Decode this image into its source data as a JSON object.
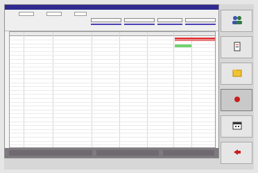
{
  "window": {
    "title": ""
  },
  "toolbar": {
    "labels": [
      "",
      "",
      ""
    ],
    "fields": [
      "",
      "",
      ""
    ],
    "buttons": [
      "",
      "",
      "",
      ""
    ]
  },
  "grid": {
    "columns": [
      "",
      "",
      "",
      "",
      "",
      "",
      ""
    ],
    "rows_count": 28
  },
  "sidebar": {
    "buttons": [
      {
        "label": "",
        "icon": "people-icon"
      },
      {
        "label": "",
        "icon": "document-icon"
      },
      {
        "label": "",
        "icon": "folder-icon"
      },
      {
        "label": "",
        "icon": "record-icon"
      },
      {
        "label": "",
        "icon": "calendar-icon"
      },
      {
        "label": "",
        "icon": "exit-icon"
      }
    ]
  },
  "colors": {
    "titlebar": "#2e2a8f",
    "accent": "#4b3fb5",
    "alert": "#e23a3a",
    "ok": "#6fd36f"
  }
}
